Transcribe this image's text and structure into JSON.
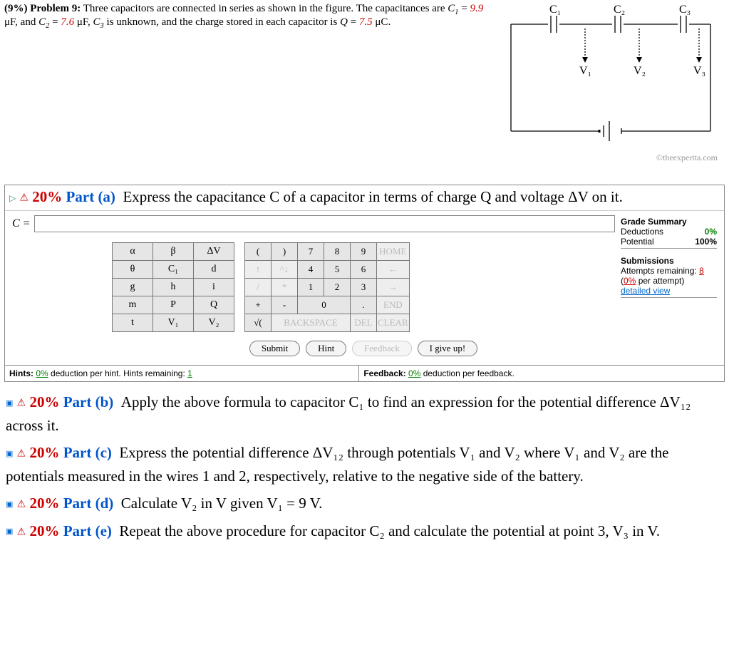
{
  "problem": {
    "prefixPct": "(9%)",
    "prefixLabel": "Problem 9:",
    "text1": "Three capacitors are connected in series as shown in the figure. The capacitances are ",
    "c1var": "C",
    "c1sub": "1",
    "c1eq": " = ",
    "c1val": "9.9",
    "unit_uf": " μF, and ",
    "c2var": "C",
    "c2sub": "2",
    "c2eq": " = ",
    "c2val": "7.6",
    "text2": " μF, ",
    "c3var": "C",
    "c3sub": "3",
    "text3": " is unknown, and the charge stored in each capacitor is ",
    "qvar": "Q",
    "qeq": " = ",
    "qval": "7.5",
    "text4": " μC."
  },
  "copyright": "©theexpertta.com",
  "circuit": {
    "C1": "C₁",
    "C2": "C₂",
    "C3": "C₃",
    "V1": "V₁",
    "V2": "V₂",
    "V3": "V₃"
  },
  "partA": {
    "pct": "20%",
    "label": "Part (a)",
    "text": "Express the capacitance C of a capacitor in terms of charge Q and voltage ΔV on it.",
    "eq": "C =",
    "grade": {
      "hdr": "Grade Summary",
      "dedLabel": "Deductions",
      "dedVal": "0%",
      "potLabel": "Potential",
      "potVal": "100%"
    },
    "subs": {
      "hdr": "Submissions",
      "attemptsText": "Attempts remaining:",
      "attemptsN": "8",
      "perAttempt": "per attempt)",
      "perPct": "0%",
      "detail": "detailed view"
    },
    "keys": {
      "r1": [
        "α",
        "β",
        "ΔV"
      ],
      "r2": [
        "θ",
        "C₁",
        "d"
      ],
      "r3": [
        "g",
        "h",
        "i"
      ],
      "r4": [
        "m",
        "P",
        "Q"
      ],
      "r5": [
        "t",
        "V₁",
        "V₂"
      ]
    },
    "num": {
      "r1": [
        "(",
        ")",
        "7",
        "8",
        "9",
        "HOME"
      ],
      "r2": [
        "↑",
        "^↓",
        "4",
        "5",
        "6",
        "←"
      ],
      "r3": [
        "/",
        "*",
        "1",
        "2",
        "3",
        "→"
      ],
      "r4": [
        "+",
        "-",
        "0",
        ".",
        "END"
      ],
      "r5": [
        "√(",
        "BACKSPACE",
        "DEL",
        "CLEAR"
      ]
    },
    "actions": {
      "submit": "Submit",
      "hint": "Hint",
      "feedback": "Feedback",
      "giveup": "I give up!"
    },
    "hintsBar": {
      "left1": "Hints:",
      "leftPct": "0%",
      "left2": " deduction per hint. Hints remaining: ",
      "leftN": "1",
      "right1": "Feedback:",
      "rightPct": "0%",
      "right2": " deduction per feedback."
    }
  },
  "otherParts": {
    "b": {
      "pct": "20%",
      "label": "Part (b)",
      "text": "Apply the above formula to capacitor C₁ to find an expression for the potential difference ΔV₁₂ across it."
    },
    "c": {
      "pct": "20%",
      "label": "Part (c)",
      "text": "Express the potential difference ΔV₁₂ through potentials V₁ and V₂ where V₁ and V₂ are the potentials measured in the wires 1 and 2, respectively, relative to the negative side of the battery."
    },
    "d": {
      "pct": "20%",
      "label": "Part (d)",
      "text": "Calculate V₂ in V given V₁ = 9 V."
    },
    "e": {
      "pct": "20%",
      "label": "Part (e)",
      "text": "Repeat the above procedure for capacitor C₂ and calculate the potential at point 3, V₃ in V."
    }
  }
}
